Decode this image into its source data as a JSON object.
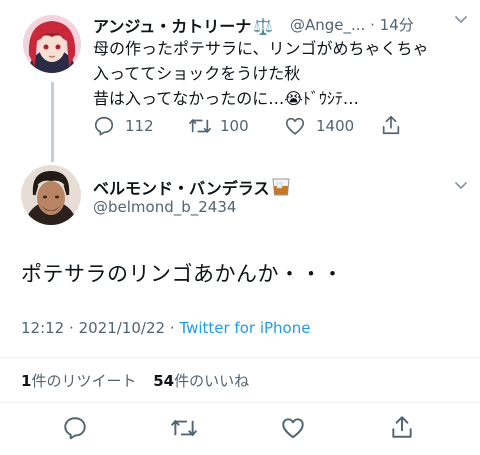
{
  "parent_tweet": {
    "display_name": "アンジュ・カトリーナ",
    "name_emoji": "⚖️",
    "handle": "@Ange_...",
    "separator": "·",
    "time": "14分",
    "text_lines": [
      "母の作ったポテサラに、リンゴがめちゃくちゃ",
      "入っててショックをうけた秋",
      "昔は入ってなかったのに…😭ﾄﾞｳｼﾃ…"
    ],
    "replies": "112",
    "retweets": "100",
    "likes": "1400"
  },
  "main_tweet": {
    "display_name": "ベルモンド・バンデラス",
    "name_emoji": "🥃",
    "handle": "@belmond_b_2434",
    "text": "ポテサラのリンゴあかんか・・・",
    "time": "12:12",
    "date_sep": "·",
    "date": "2021/10/22",
    "source_sep": "·",
    "source": "Twitter for iPhone"
  },
  "stats": {
    "retweet_count": "1",
    "retweet_label": "件のリツイート",
    "like_count": "54",
    "like_label": "件のいいね"
  },
  "icons": {
    "reply": "reply-icon",
    "retweet": "retweet-icon",
    "like": "heart-icon",
    "share": "share-icon",
    "more": "chevron-down-icon"
  },
  "colors": {
    "link": "#1d9bf0",
    "muted": "#536471",
    "text": "#0f1419"
  }
}
